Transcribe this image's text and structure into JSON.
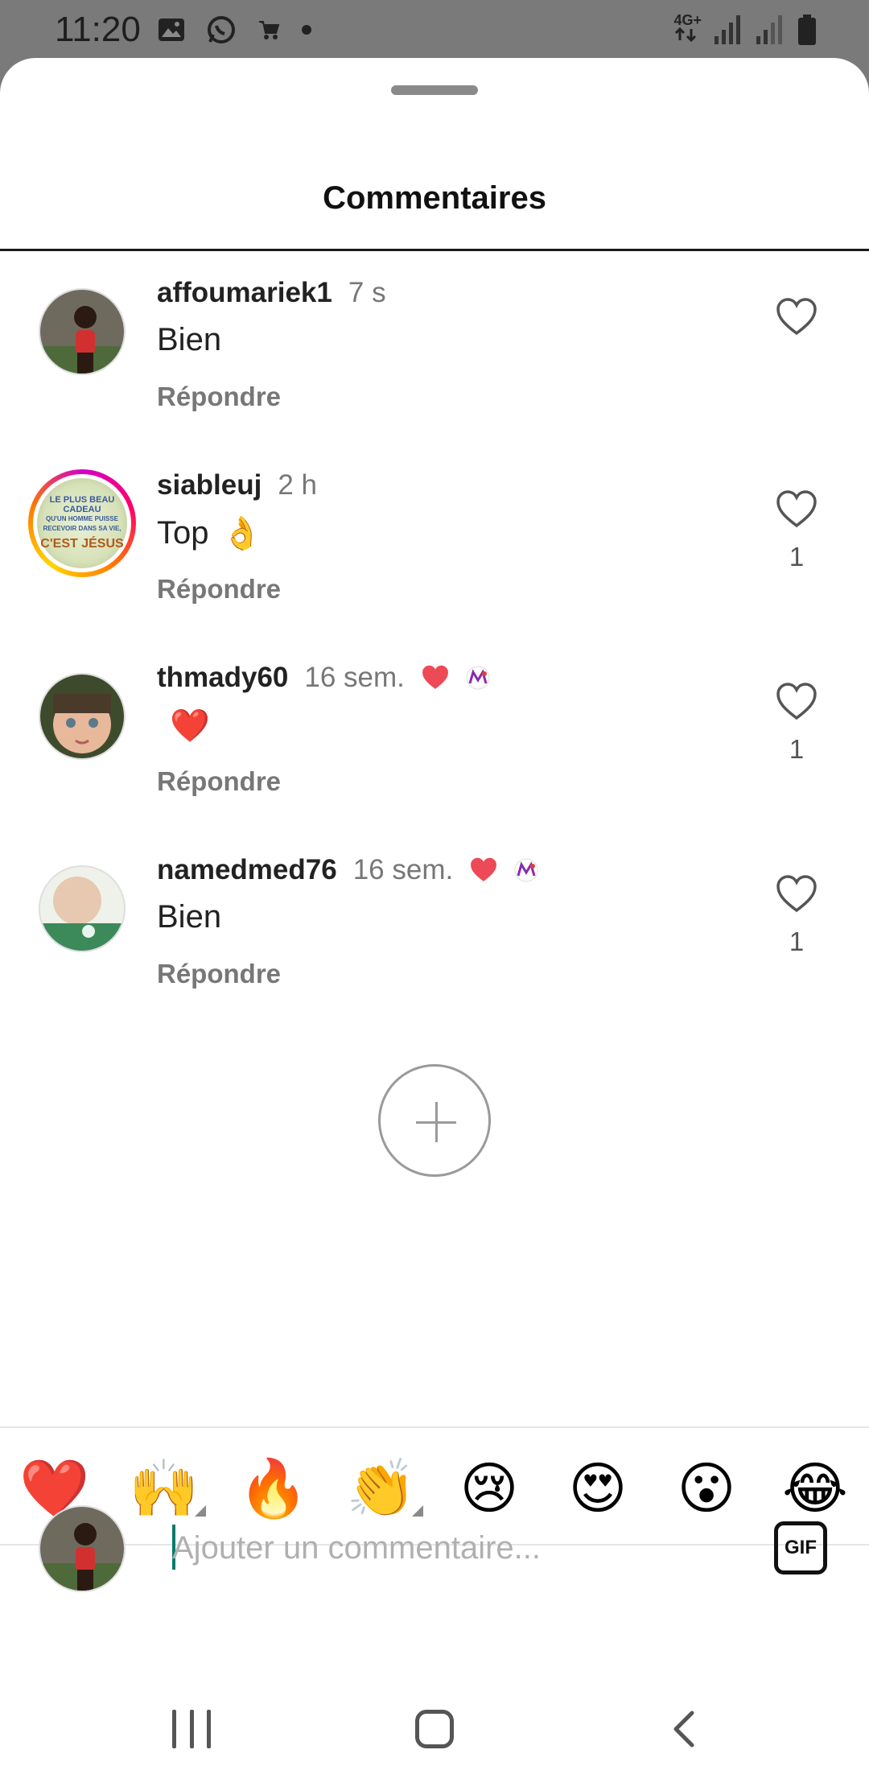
{
  "status_bar": {
    "time": "11:20",
    "network": "4G+",
    "left_icons": [
      "gallery-icon",
      "whatsapp-icon",
      "cart-icon",
      "dot-icon"
    ],
    "right_icons": [
      "network-arrows-icon",
      "signal-icon",
      "signal-icon",
      "battery-icon"
    ]
  },
  "sheet": {
    "title": "Commentaires"
  },
  "comments": [
    {
      "username": "affoumariek1",
      "time": "7 s",
      "text": "Bien",
      "reply_label": "Répondre",
      "like_count": ""
    },
    {
      "username": "siableuj",
      "time": "2 h",
      "text": "Top",
      "text_emoji": "👌",
      "reply_label": "Répondre",
      "like_count": "1",
      "avatar_text": {
        "line1": "LE PLUS BEAU CADEAU",
        "line2": "QU'UN HOMME PUISSE RECEVOIR DANS SA VIE,",
        "line3": "C'EST JÉSUS"
      }
    },
    {
      "username": "thmady60",
      "time": "16 sem.",
      "text": "",
      "text_emoji": "❤️",
      "reply_label": "Répondre",
      "like_count": "1",
      "badges": [
        "liked-by-author-heart-icon",
        "creator-avatar-icon"
      ]
    },
    {
      "username": "namedmed76",
      "time": "16 sem.",
      "text": "Bien",
      "reply_label": "Répondre",
      "like_count": "1",
      "badges": [
        "liked-by-author-heart-icon",
        "creator-avatar-icon"
      ]
    }
  ],
  "emoji_bar": [
    "❤️",
    "🙌",
    "🔥",
    "👏",
    "😢",
    "😍",
    "😮",
    "😂"
  ],
  "composer": {
    "placeholder": "Ajouter un commentaire...",
    "gif_label": "GIF"
  },
  "colors": {
    "accent_heart": "#ed4956",
    "caret": "#0a7a6a",
    "muted_text": "#777777"
  }
}
